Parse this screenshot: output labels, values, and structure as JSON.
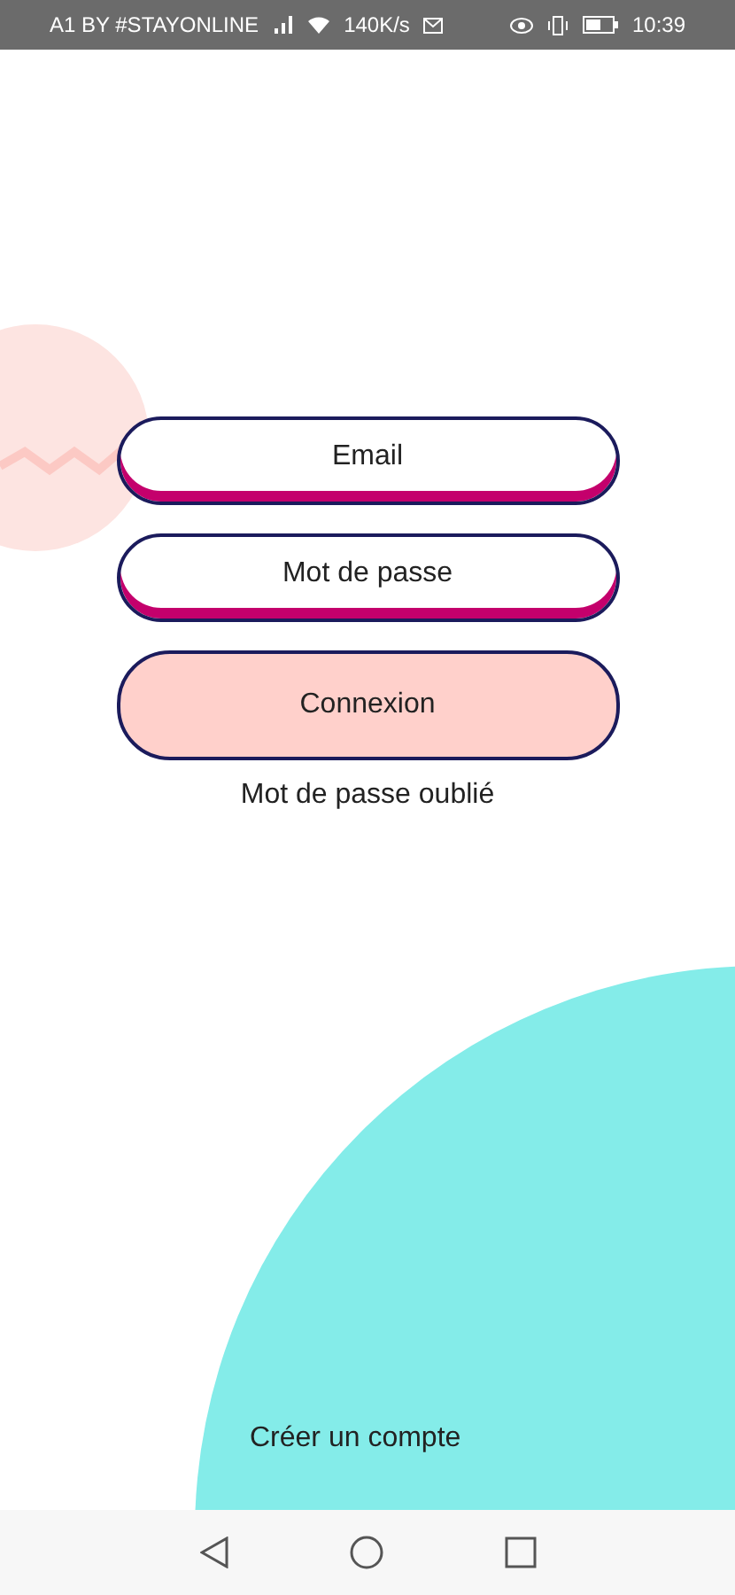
{
  "status_bar": {
    "carrier": "A1 BY #STAYONLINE",
    "speed": "140K/s",
    "time": "10:39"
  },
  "fields": [
    {
      "placeholder": "Email"
    },
    {
      "placeholder": "Mot de passe"
    }
  ],
  "login_button": "Connexion",
  "forgot_link": "Mot de passe oublié",
  "create_account_link": "Créer un compte"
}
